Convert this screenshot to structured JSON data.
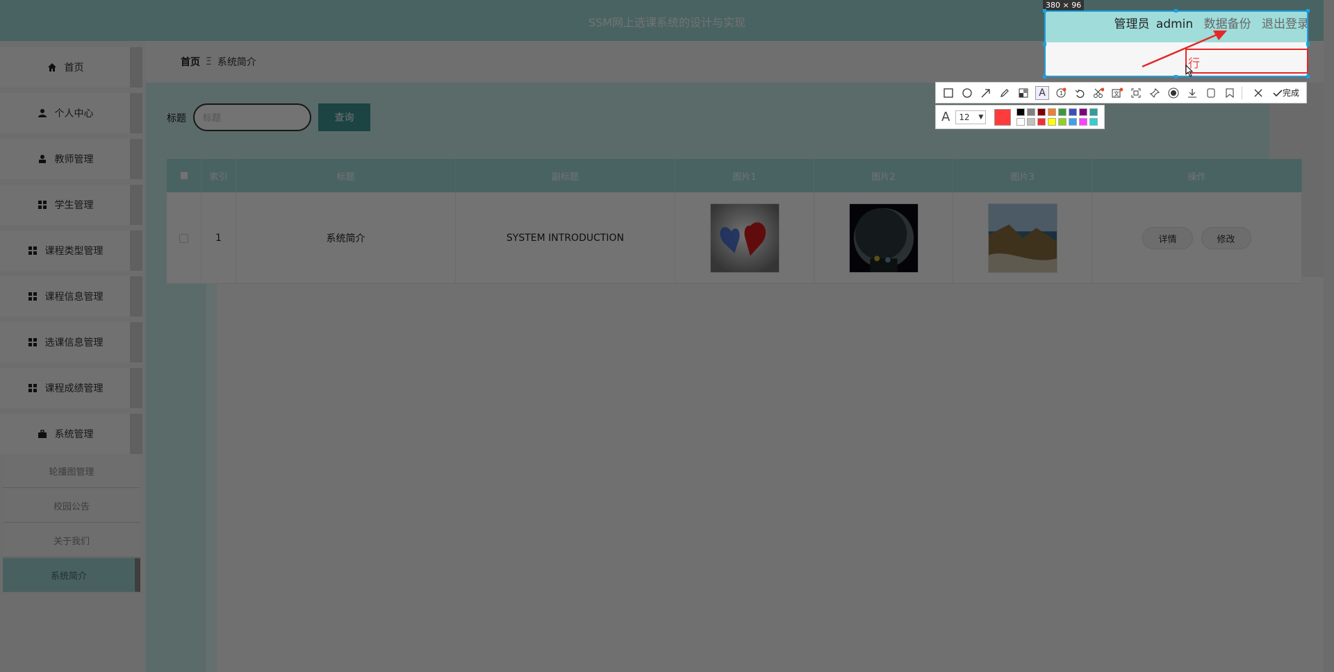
{
  "header": {
    "title": "SSM网上选课系统的设计与实现",
    "user_role": "管理员",
    "username": "admin",
    "backup_link": "数据备份",
    "logout_link": "退出登录"
  },
  "sidebar": {
    "items": [
      {
        "label": "首页",
        "icon": "home-icon"
      },
      {
        "label": "个人中心",
        "icon": "user-icon"
      },
      {
        "label": "教师管理",
        "icon": "teacher-icon"
      },
      {
        "label": "学生管理",
        "icon": "grid-icon"
      },
      {
        "label": "课程类型管理",
        "icon": "grid-icon"
      },
      {
        "label": "课程信息管理",
        "icon": "grid-icon"
      },
      {
        "label": "选课信息管理",
        "icon": "grid-icon"
      },
      {
        "label": "课程成绩管理",
        "icon": "grid-icon"
      },
      {
        "label": "系统管理",
        "icon": "briefcase-icon"
      }
    ],
    "sub_items": [
      {
        "label": "轮播图管理"
      },
      {
        "label": "校园公告"
      },
      {
        "label": "关于我们"
      },
      {
        "label": "系统简介"
      }
    ]
  },
  "breadcrumb": {
    "home": "首页",
    "separator": "Ξ",
    "current": "系统简介"
  },
  "search": {
    "label": "标题",
    "placeholder": "标题",
    "button": "查询"
  },
  "table": {
    "columns": [
      "索引",
      "标题",
      "副标题",
      "图片1",
      "图片2",
      "图片3",
      "操作"
    ],
    "rows": [
      {
        "index": "1",
        "title": "系统简介",
        "subtitle": "SYSTEM INTRODUCTION",
        "detail_label": "详情",
        "edit_label": "修改"
      }
    ]
  },
  "capture_tool": {
    "size_label": "380 × 96",
    "annotation_text": "行",
    "font_size": "12",
    "done_label": "完成",
    "current_color": "#ff3b3b",
    "palette": [
      "#000000",
      "#808080",
      "#800000",
      "#f08030",
      "#3a9a3a",
      "#3a50c0",
      "#800080",
      "#2aa0a0",
      "#ffffff",
      "#c0c0c0",
      "#f03030",
      "#ffff00",
      "#90d020",
      "#40a0f0",
      "#ff40ff",
      "#30d0d0"
    ]
  }
}
